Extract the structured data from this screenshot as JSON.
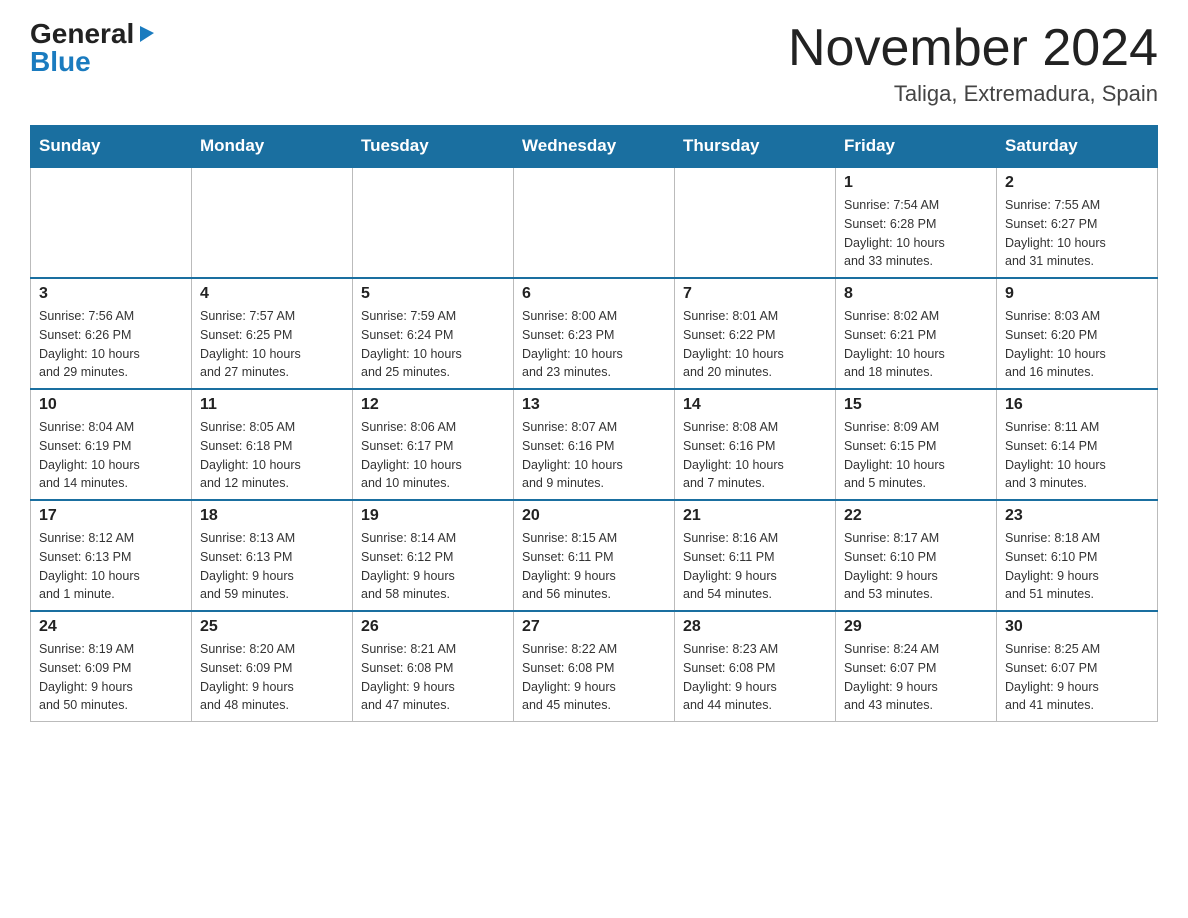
{
  "logo": {
    "general": "General",
    "triangle": "▶",
    "blue": "Blue"
  },
  "title": "November 2024",
  "subtitle": "Taliga, Extremadura, Spain",
  "weekdays": [
    "Sunday",
    "Monday",
    "Tuesday",
    "Wednesday",
    "Thursday",
    "Friday",
    "Saturday"
  ],
  "weeks": [
    [
      {
        "day": "",
        "info": ""
      },
      {
        "day": "",
        "info": ""
      },
      {
        "day": "",
        "info": ""
      },
      {
        "day": "",
        "info": ""
      },
      {
        "day": "",
        "info": ""
      },
      {
        "day": "1",
        "info": "Sunrise: 7:54 AM\nSunset: 6:28 PM\nDaylight: 10 hours\nand 33 minutes."
      },
      {
        "day": "2",
        "info": "Sunrise: 7:55 AM\nSunset: 6:27 PM\nDaylight: 10 hours\nand 31 minutes."
      }
    ],
    [
      {
        "day": "3",
        "info": "Sunrise: 7:56 AM\nSunset: 6:26 PM\nDaylight: 10 hours\nand 29 minutes."
      },
      {
        "day": "4",
        "info": "Sunrise: 7:57 AM\nSunset: 6:25 PM\nDaylight: 10 hours\nand 27 minutes."
      },
      {
        "day": "5",
        "info": "Sunrise: 7:59 AM\nSunset: 6:24 PM\nDaylight: 10 hours\nand 25 minutes."
      },
      {
        "day": "6",
        "info": "Sunrise: 8:00 AM\nSunset: 6:23 PM\nDaylight: 10 hours\nand 23 minutes."
      },
      {
        "day": "7",
        "info": "Sunrise: 8:01 AM\nSunset: 6:22 PM\nDaylight: 10 hours\nand 20 minutes."
      },
      {
        "day": "8",
        "info": "Sunrise: 8:02 AM\nSunset: 6:21 PM\nDaylight: 10 hours\nand 18 minutes."
      },
      {
        "day": "9",
        "info": "Sunrise: 8:03 AM\nSunset: 6:20 PM\nDaylight: 10 hours\nand 16 minutes."
      }
    ],
    [
      {
        "day": "10",
        "info": "Sunrise: 8:04 AM\nSunset: 6:19 PM\nDaylight: 10 hours\nand 14 minutes."
      },
      {
        "day": "11",
        "info": "Sunrise: 8:05 AM\nSunset: 6:18 PM\nDaylight: 10 hours\nand 12 minutes."
      },
      {
        "day": "12",
        "info": "Sunrise: 8:06 AM\nSunset: 6:17 PM\nDaylight: 10 hours\nand 10 minutes."
      },
      {
        "day": "13",
        "info": "Sunrise: 8:07 AM\nSunset: 6:16 PM\nDaylight: 10 hours\nand 9 minutes."
      },
      {
        "day": "14",
        "info": "Sunrise: 8:08 AM\nSunset: 6:16 PM\nDaylight: 10 hours\nand 7 minutes."
      },
      {
        "day": "15",
        "info": "Sunrise: 8:09 AM\nSunset: 6:15 PM\nDaylight: 10 hours\nand 5 minutes."
      },
      {
        "day": "16",
        "info": "Sunrise: 8:11 AM\nSunset: 6:14 PM\nDaylight: 10 hours\nand 3 minutes."
      }
    ],
    [
      {
        "day": "17",
        "info": "Sunrise: 8:12 AM\nSunset: 6:13 PM\nDaylight: 10 hours\nand 1 minute."
      },
      {
        "day": "18",
        "info": "Sunrise: 8:13 AM\nSunset: 6:13 PM\nDaylight: 9 hours\nand 59 minutes."
      },
      {
        "day": "19",
        "info": "Sunrise: 8:14 AM\nSunset: 6:12 PM\nDaylight: 9 hours\nand 58 minutes."
      },
      {
        "day": "20",
        "info": "Sunrise: 8:15 AM\nSunset: 6:11 PM\nDaylight: 9 hours\nand 56 minutes."
      },
      {
        "day": "21",
        "info": "Sunrise: 8:16 AM\nSunset: 6:11 PM\nDaylight: 9 hours\nand 54 minutes."
      },
      {
        "day": "22",
        "info": "Sunrise: 8:17 AM\nSunset: 6:10 PM\nDaylight: 9 hours\nand 53 minutes."
      },
      {
        "day": "23",
        "info": "Sunrise: 8:18 AM\nSunset: 6:10 PM\nDaylight: 9 hours\nand 51 minutes."
      }
    ],
    [
      {
        "day": "24",
        "info": "Sunrise: 8:19 AM\nSunset: 6:09 PM\nDaylight: 9 hours\nand 50 minutes."
      },
      {
        "day": "25",
        "info": "Sunrise: 8:20 AM\nSunset: 6:09 PM\nDaylight: 9 hours\nand 48 minutes."
      },
      {
        "day": "26",
        "info": "Sunrise: 8:21 AM\nSunset: 6:08 PM\nDaylight: 9 hours\nand 47 minutes."
      },
      {
        "day": "27",
        "info": "Sunrise: 8:22 AM\nSunset: 6:08 PM\nDaylight: 9 hours\nand 45 minutes."
      },
      {
        "day": "28",
        "info": "Sunrise: 8:23 AM\nSunset: 6:08 PM\nDaylight: 9 hours\nand 44 minutes."
      },
      {
        "day": "29",
        "info": "Sunrise: 8:24 AM\nSunset: 6:07 PM\nDaylight: 9 hours\nand 43 minutes."
      },
      {
        "day": "30",
        "info": "Sunrise: 8:25 AM\nSunset: 6:07 PM\nDaylight: 9 hours\nand 41 minutes."
      }
    ]
  ]
}
